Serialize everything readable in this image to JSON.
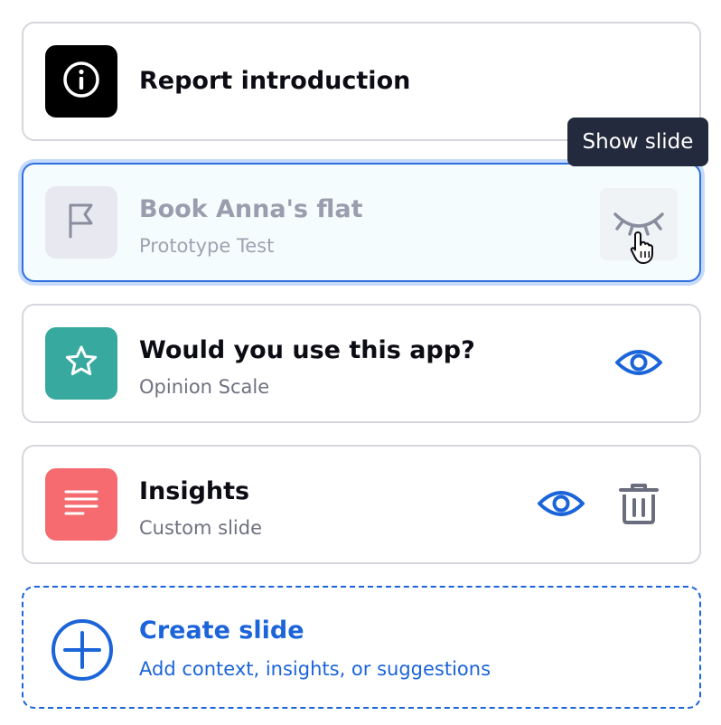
{
  "slides": [
    {
      "title": "Report introduction",
      "icon": "info-icon",
      "tile_color": "#000000"
    },
    {
      "title": "Book Anna's flat",
      "subtitle": "Prototype Test",
      "icon": "flag-icon",
      "tile_color": "#e8e8f1",
      "state": "hidden"
    },
    {
      "title": "Would you use this app?",
      "subtitle": "Opinion Scale",
      "icon": "star-icon",
      "tile_color": "#37a99f"
    },
    {
      "title": "Insights",
      "subtitle": "Custom slide",
      "icon": "text-lines-icon",
      "tile_color": "#f66b70"
    }
  ],
  "tooltip": {
    "text": "Show slide"
  },
  "create": {
    "title": "Create slide",
    "subtitle": "Add context, insights, or suggestions",
    "icon": "plus-circle-icon"
  },
  "colors": {
    "accent": "#1b64d9",
    "tooltip_bg": "#242a3d",
    "border": "#d6d7de"
  }
}
